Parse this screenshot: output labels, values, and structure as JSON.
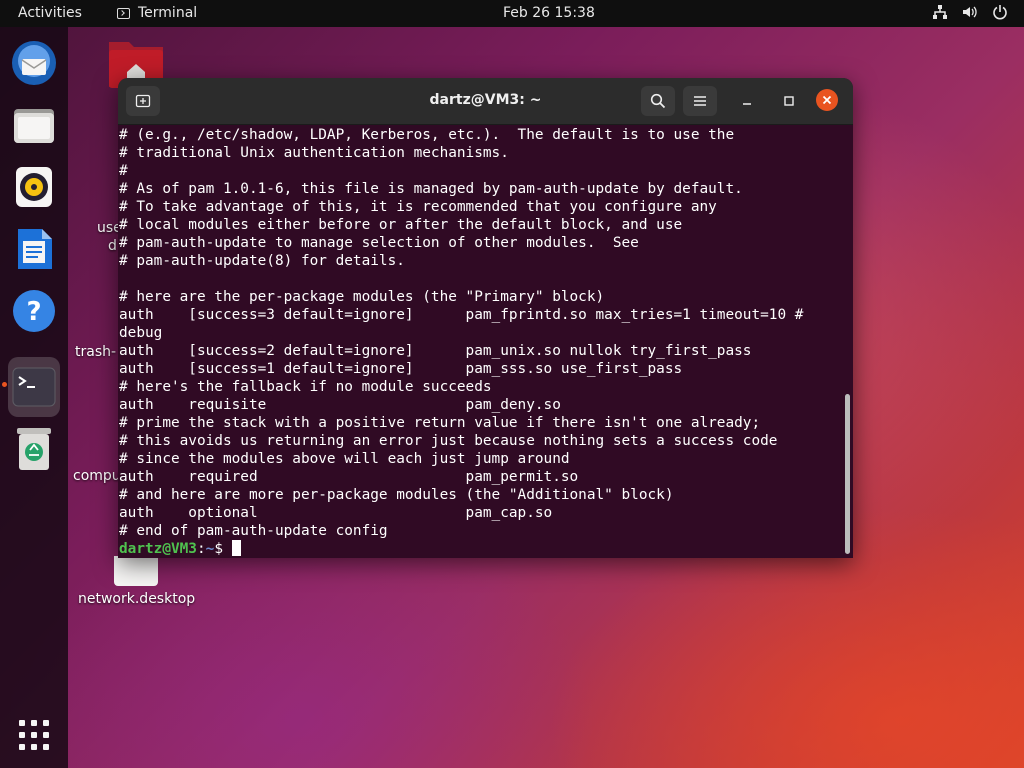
{
  "topbar": {
    "activities": "Activities",
    "app_name": "Terminal",
    "clock": "Feb 26  15:38",
    "tray_icons": [
      "network-icon",
      "volume-icon",
      "power-icon"
    ]
  },
  "dock": {
    "items": [
      {
        "name": "thunderbird-icon"
      },
      {
        "name": "files-icon"
      },
      {
        "name": "rhythmbox-icon"
      },
      {
        "name": "libreoffice-writer-icon"
      },
      {
        "name": "help-icon"
      },
      {
        "name": "terminal-icon",
        "active": true
      },
      {
        "name": "trash-icon"
      },
      {
        "name": "show-apps-icon"
      }
    ]
  },
  "desktop": {
    "labels": {
      "users_partial": "use",
      "users_partial2": "d",
      "trash_partial": "trash-",
      "computer_partial": "compu",
      "network": "network.desktop"
    }
  },
  "terminal": {
    "title": "dartz@VM3: ~",
    "lines": [
      "# (e.g., /etc/shadow, LDAP, Kerberos, etc.).  The default is to use the",
      "# traditional Unix authentication mechanisms.",
      "#",
      "# As of pam 1.0.1-6, this file is managed by pam-auth-update by default.",
      "# To take advantage of this, it is recommended that you configure any",
      "# local modules either before or after the default block, and use",
      "# pam-auth-update to manage selection of other modules.  See",
      "# pam-auth-update(8) for details.",
      "",
      "# here are the per-package modules (the \"Primary\" block)",
      "auth    [success=3 default=ignore]      pam_fprintd.so max_tries=1 timeout=10 #",
      "debug",
      "auth    [success=2 default=ignore]      pam_unix.so nullok try_first_pass",
      "auth    [success=1 default=ignore]      pam_sss.so use_first_pass",
      "# here's the fallback if no module succeeds",
      "auth    requisite                       pam_deny.so",
      "# prime the stack with a positive return value if there isn't one already;",
      "# this avoids us returning an error just because nothing sets a success code",
      "# since the modules above will each just jump around",
      "auth    required                        pam_permit.so",
      "# and here are more per-package modules (the \"Additional\" block)",
      "auth    optional                        pam_cap.so",
      "# end of pam-auth-update config"
    ],
    "prompt_user": "dartz@VM3",
    "prompt_sep": ":",
    "prompt_path": "~",
    "prompt_symbol": "$ "
  },
  "colors": {
    "terminal_bg": "#300a24",
    "accent": "#e95420",
    "prompt_user": "#4fc14f",
    "prompt_path": "#6d8ccf"
  }
}
